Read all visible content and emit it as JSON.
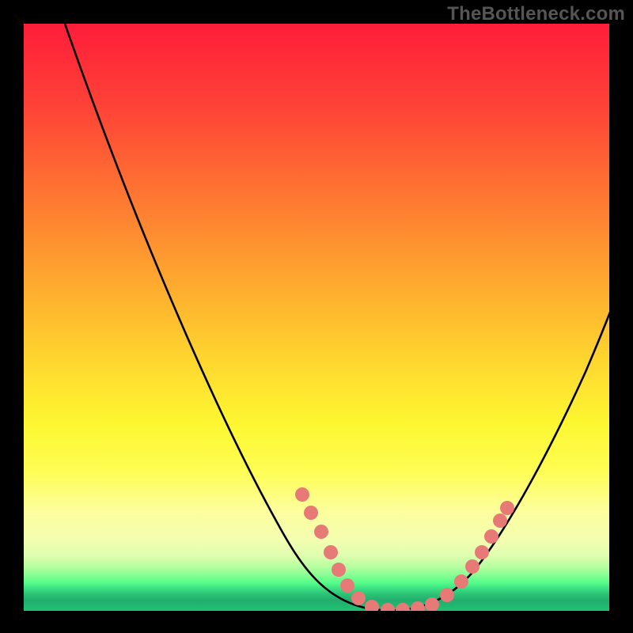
{
  "watermark": "TheBottleneck.com",
  "chart_data": {
    "type": "line",
    "title": "",
    "xlabel": "",
    "ylabel": "",
    "xlim": [
      0,
      100
    ],
    "ylim": [
      0,
      100
    ],
    "grid": false,
    "legend": false,
    "series": [
      {
        "name": "bottleneck-curve",
        "x": [
          7,
          12,
          17,
          22,
          27,
          32,
          37,
          42,
          47,
          52,
          56,
          60,
          64,
          68,
          72,
          76,
          80,
          84,
          88,
          92,
          95,
          98
        ],
        "y": [
          100,
          90,
          80,
          70,
          60,
          50,
          40,
          30,
          20,
          11,
          5,
          1,
          0,
          0,
          1,
          5,
          12,
          21,
          31,
          41,
          48,
          55
        ]
      }
    ],
    "markers": {
      "name": "highlighted-points",
      "color": "#e77a77",
      "x": [
        47.5,
        49.5,
        51.5,
        54.0,
        56.5,
        60.0,
        62.0,
        64.0,
        66.0,
        68.0,
        70.0,
        73.0,
        75.0,
        77.0,
        79.0,
        81.0
      ],
      "y": [
        19,
        16,
        12,
        7,
        4,
        1,
        0,
        0,
        0,
        0,
        1,
        3,
        6,
        10,
        14,
        18
      ]
    },
    "background_gradient": {
      "top": "#fe1d3a",
      "mid1": "#feac2e",
      "mid2": "#fefd35",
      "lower": "#fdfea2",
      "bottom_stripes": [
        "#cbfe9f",
        "#6afe8f",
        "#32d57c",
        "#21b06e",
        "#1fbf73"
      ]
    },
    "frame_color": "#000000"
  }
}
